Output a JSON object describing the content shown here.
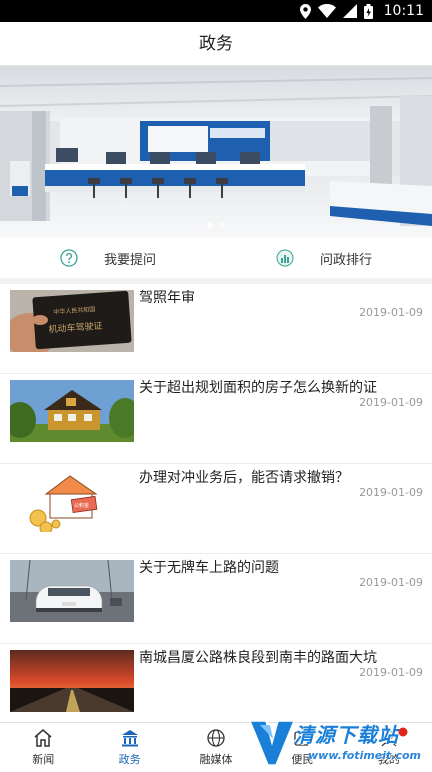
{
  "status_bar": {
    "time": "10:11"
  },
  "header": {
    "title": "政务"
  },
  "banner": {
    "slide_count": 2,
    "active_slide": 0
  },
  "quick_actions": [
    {
      "label": "我要提问",
      "icon": "question-circle-icon"
    },
    {
      "label": "问政排行",
      "icon": "ranking-chart-icon"
    }
  ],
  "news": [
    {
      "title": "驾照年审",
      "date": "2019-01-09",
      "thumb": "driver-license-photo"
    },
    {
      "title": "关于超出规划面积的房子怎么换新的证",
      "date": "2019-01-09",
      "thumb": "house-photo"
    },
    {
      "title": "办理对冲业务后，能否请求撤销？",
      "date": "2019-01-09",
      "thumb": "house-coins-illustration"
    },
    {
      "title": "关于无牌车上路的问题",
      "date": "2019-01-09",
      "thumb": "white-car-photo"
    },
    {
      "title": "南城昌厦公路株良段到南丰的路面大坑",
      "date": "2019-01-09",
      "thumb": "sunset-road-photo"
    }
  ],
  "tabs": [
    {
      "label": "新闻",
      "icon": "home-icon",
      "active": false
    },
    {
      "label": "政务",
      "icon": "government-building-icon",
      "active": true
    },
    {
      "label": "融媒体",
      "icon": "globe-icon",
      "active": false
    },
    {
      "label": "便民",
      "icon": "service-icon",
      "active": false
    },
    {
      "label": "我的",
      "icon": "user-icon",
      "active": false
    }
  ],
  "watermark": {
    "text": "清源下载站",
    "url": "www.fotimeit.com"
  },
  "colors": {
    "accent": "#1a67b7",
    "banner_blue": "#1f5fb0",
    "divider": "#ececec",
    "date_gray": "#999999"
  }
}
